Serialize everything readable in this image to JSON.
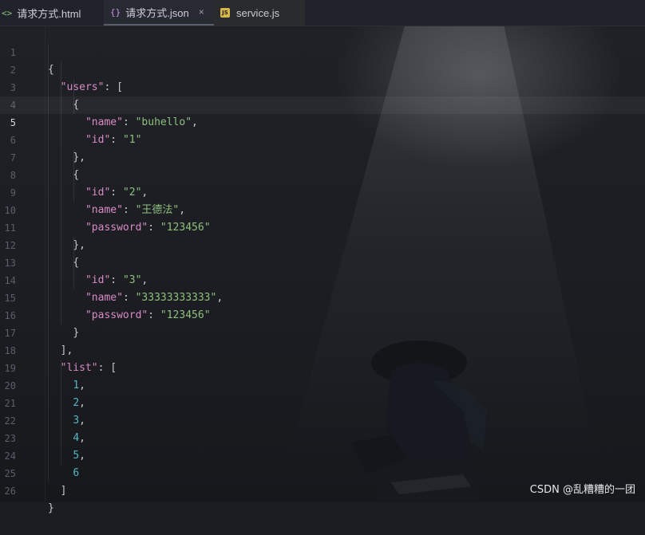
{
  "tabs": [
    {
      "icon": "<>",
      "label": "请求方式.html"
    },
    {
      "icon": "{}",
      "label": "请求方式.json",
      "close": "×"
    },
    {
      "icon": "JS",
      "label": "service.js"
    }
  ],
  "editor": {
    "active_line": 5,
    "line_numbers": [
      "1",
      "2",
      "3",
      "4",
      "5",
      "6",
      "7",
      "8",
      "9",
      "10",
      "11",
      "12",
      "13",
      "14",
      "15",
      "16",
      "17",
      "18",
      "19",
      "20",
      "21",
      "22",
      "23",
      "24",
      "25",
      "26"
    ],
    "json_text": {
      "users_key": "\"users\"",
      "list_key": "\"list\"",
      "name_key": "\"name\"",
      "id_key": "\"id\"",
      "password_key": "\"password\"",
      "u1_name": "\"buhello\"",
      "u1_id": "\"1\"",
      "u2_id": "\"2\"",
      "u2_name": "\"王德法\"",
      "u2_password": "\"123456\"",
      "u3_id": "\"3\"",
      "u3_name": "\"33333333333\"",
      "u3_password": "\"123456\"",
      "list_values": [
        "1",
        "2",
        "3",
        "4",
        "5",
        "6"
      ]
    }
  },
  "watermark": "CSDN @乱糟糟的一团"
}
